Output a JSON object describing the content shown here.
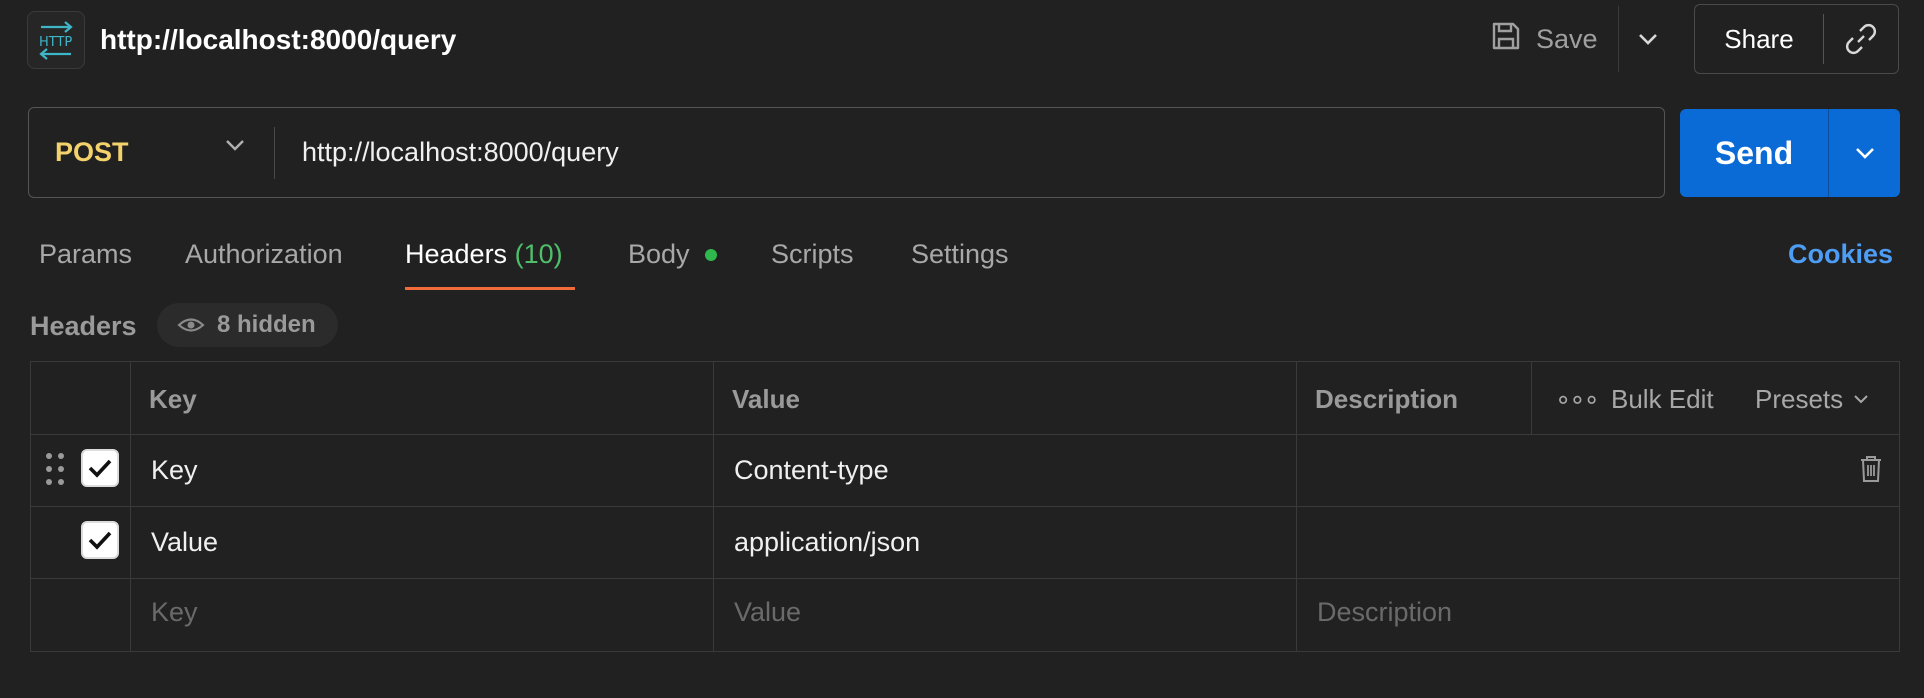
{
  "header": {
    "title": "http://localhost:8000/query",
    "http_badge": "HTTP",
    "save_label": "Save",
    "share_label": "Share"
  },
  "request": {
    "method": "POST",
    "url": "http://localhost:8000/query",
    "send_label": "Send"
  },
  "tabs": [
    {
      "label": "Params"
    },
    {
      "label": "Authorization"
    },
    {
      "label": "Headers",
      "count": "(10)",
      "active": true
    },
    {
      "label": "Body",
      "has_dot": true
    },
    {
      "label": "Scripts"
    },
    {
      "label": "Settings"
    }
  ],
  "cookies_label": "Cookies",
  "headers_section": {
    "label": "Headers",
    "hidden_count": "8 hidden"
  },
  "table": {
    "columns": {
      "key": "Key",
      "value": "Value",
      "description": "Description"
    },
    "tools": {
      "more": "∘∘∘",
      "bulk_edit": "Bulk Edit",
      "presets": "Presets"
    },
    "rows": [
      {
        "checked": true,
        "key": "Key",
        "value": "Content-type",
        "description": ""
      },
      {
        "checked": true,
        "key": "Value",
        "value": "application/json",
        "description": ""
      }
    ],
    "placeholder_row": {
      "key": "Key",
      "value": "Value",
      "description": "Description"
    }
  },
  "colors": {
    "background": "#212121",
    "method": "#f3d26b",
    "send": "#0a6bd6",
    "active_tab_underline": "#f26b3a",
    "count_green": "#4fbf6b",
    "link_blue": "#4d9df5"
  }
}
